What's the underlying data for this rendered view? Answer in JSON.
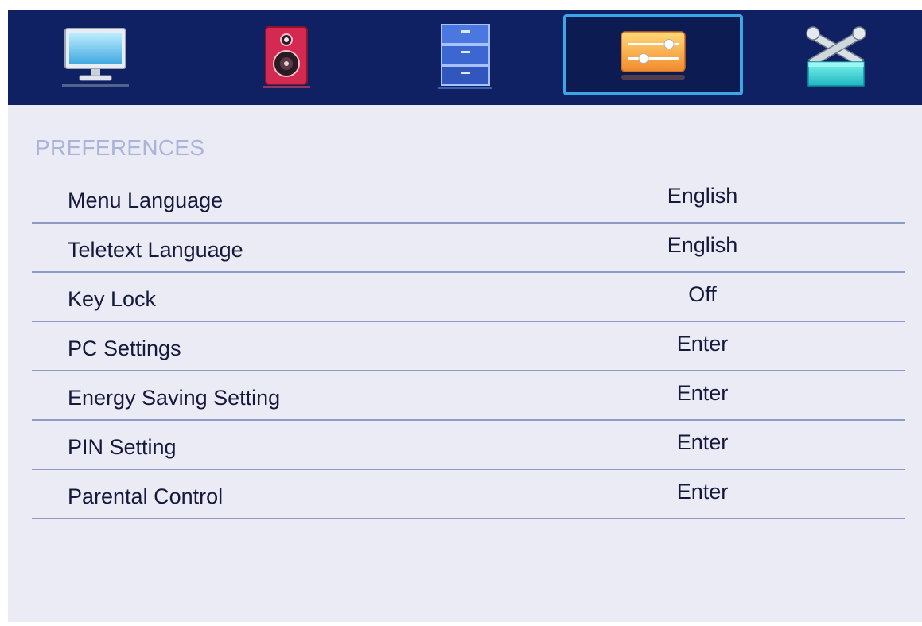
{
  "tabs": [
    {
      "icon": "monitor-icon",
      "selected": false
    },
    {
      "icon": "speaker-icon",
      "selected": false
    },
    {
      "icon": "cabinet-icon",
      "selected": false
    },
    {
      "icon": "sliders-icon",
      "selected": true
    },
    {
      "icon": "tools-icon",
      "selected": false
    }
  ],
  "section": {
    "title": "PREFERENCES"
  },
  "menu": {
    "items": [
      {
        "label": "Menu Language",
        "value": "English"
      },
      {
        "label": "Teletext Language",
        "value": "English"
      },
      {
        "label": "Key Lock",
        "value": "Off"
      },
      {
        "label": "PC Settings",
        "value": "Enter"
      },
      {
        "label": "Energy Saving Setting",
        "value": "Enter"
      },
      {
        "label": "PIN Setting",
        "value": "Enter"
      },
      {
        "label": "Parental Control",
        "value": "Enter"
      }
    ]
  },
  "colors": {
    "topbar": "#0f2163",
    "background": "#eaebf5",
    "selected_border": "#3ba7e6",
    "section_title": "#aab4d8",
    "row_divider": "#8d9ac6",
    "text": "#15193a"
  }
}
